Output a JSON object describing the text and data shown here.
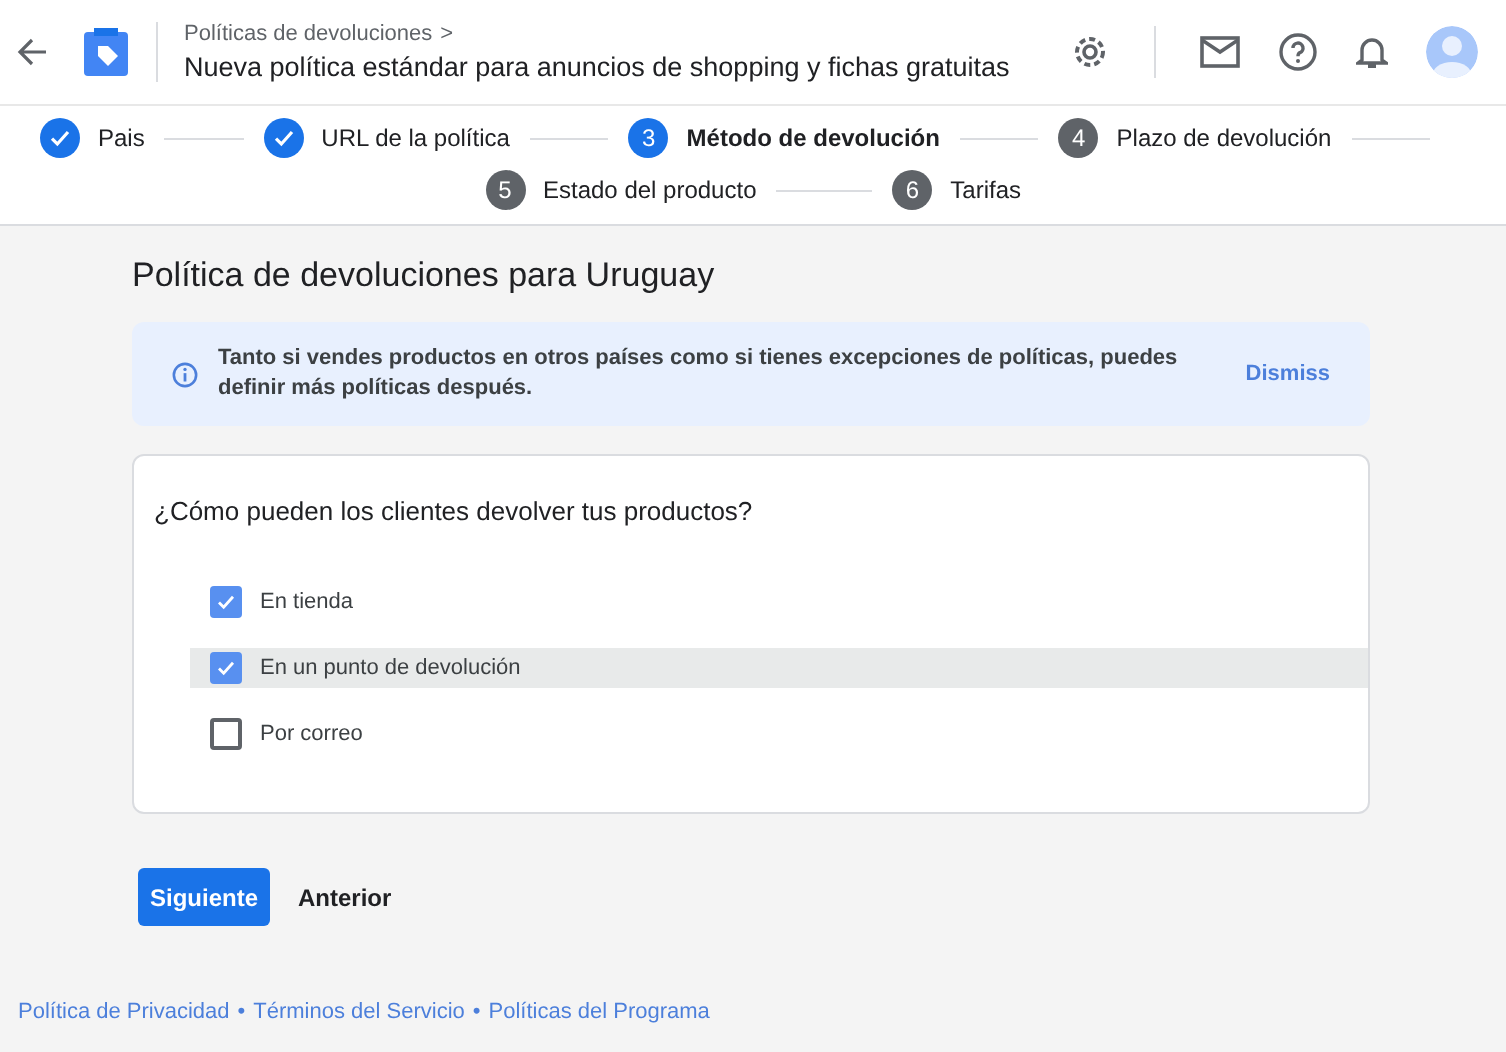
{
  "header": {
    "breadcrumb": "Políticas de devoluciones",
    "breadcrumb_arrow": ">",
    "title": "Nueva política estándar para anuncios de shopping y fichas gratuitas"
  },
  "stepper": {
    "rows": [
      [
        {
          "label": "Pais",
          "kind": "done"
        },
        {
          "label": "URL de la política",
          "kind": "done"
        },
        {
          "label": "Método de devolución",
          "kind": "current",
          "number": "3"
        },
        {
          "label": "Plazo de devolución",
          "kind": "todo",
          "number": "4"
        }
      ],
      [
        {
          "label": "Estado del producto",
          "kind": "todo",
          "number": "5"
        },
        {
          "label": "Tarifas",
          "kind": "todo",
          "number": "6"
        }
      ]
    ]
  },
  "page_title": "Política de devoluciones para Uruguay",
  "banner": {
    "text": "Tanto si vendes productos en otros países como si tienes excepciones de políticas, puedes definir más políticas después.",
    "action": "Dismiss"
  },
  "question": {
    "prompt": "¿Cómo pueden los clientes devolver tus productos?",
    "options": [
      {
        "label": "En tienda",
        "checked": true,
        "highlighted": false
      },
      {
        "label": "En un punto de devolución",
        "checked": true,
        "highlighted": true
      },
      {
        "label": "Por correo",
        "checked": false,
        "highlighted": false
      }
    ]
  },
  "buttons": {
    "next": "Siguiente",
    "back": "Anterior"
  },
  "footer": {
    "links": [
      "Política de Privacidad",
      "Términos del Servicio",
      "Políticas del Programa"
    ],
    "separator": "•"
  }
}
